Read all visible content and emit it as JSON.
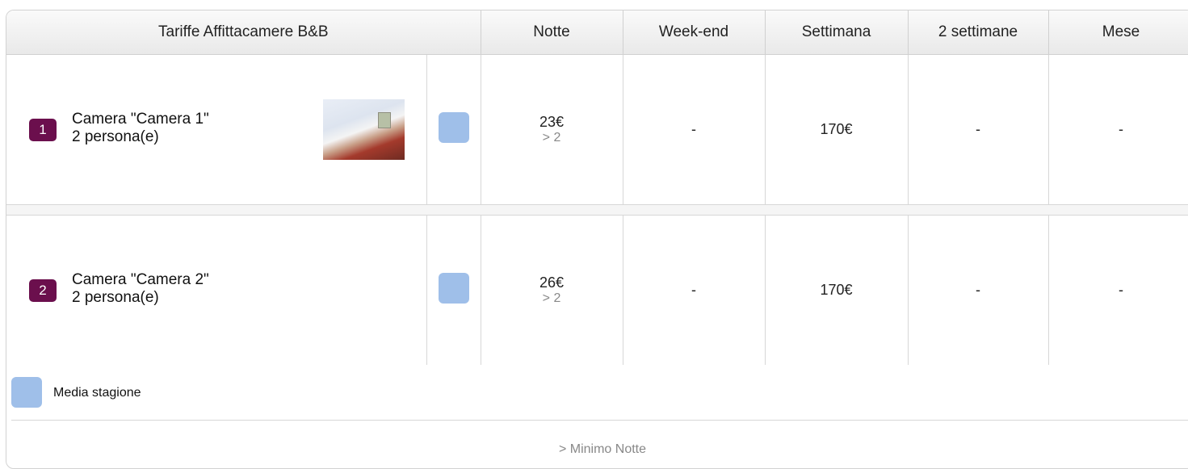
{
  "table": {
    "title": "Tariffe Affittacamere B&B",
    "columns": [
      "Notte",
      "Week-end",
      "Settimana",
      "2 settimane",
      "Mese"
    ],
    "rows": [
      {
        "number": "1",
        "name": "Camera \"Camera 1\"",
        "capacity": "2 persona(e)",
        "has_photo": true,
        "season_color": "#9fbfe9",
        "notte": "23€",
        "notte_min": "> 2",
        "weekend": "-",
        "settimana": "170€",
        "due_settimane": "-",
        "mese": "-"
      },
      {
        "number": "2",
        "name": "Camera \"Camera 2\"",
        "capacity": "2 persona(e)",
        "has_photo": false,
        "season_color": "#9fbfe9",
        "notte": "26€",
        "notte_min": "> 2",
        "weekend": "-",
        "settimana": "170€",
        "due_settimane": "-",
        "mese": "-"
      }
    ]
  },
  "legend": {
    "season_label": "Media stagione",
    "season_color": "#9fbfe9",
    "footnote": "> Minimo Notte"
  },
  "colors": {
    "badge": "#6b0f4d",
    "border": "#d2d2d2"
  }
}
